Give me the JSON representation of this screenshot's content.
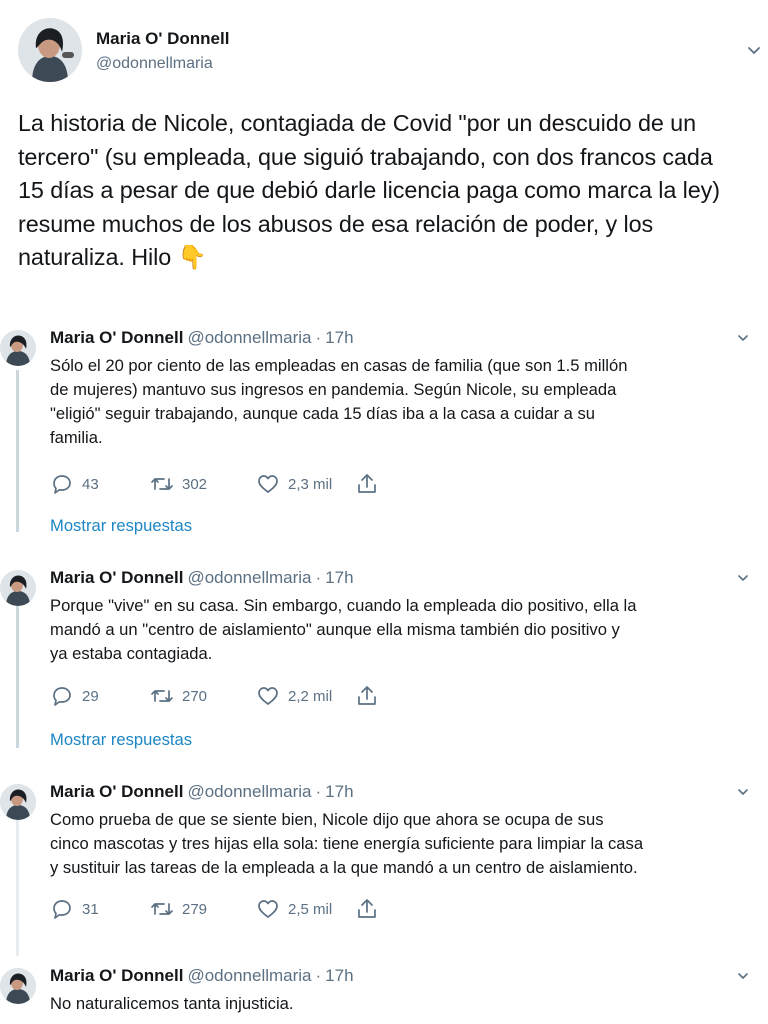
{
  "main_tweet": {
    "author_name": "Maria O' Donnell",
    "author_handle": "@odonnellmaria",
    "text": "La historia de Nicole, contagiada de Covid \"por un descuido de un\ntercero\" (su empleada, que siguió trabajando, con dos francos cada\n15 días a pesar de que debió darle licencia paga como marca la ley)\nresume muchos de los abusos de esa relación de poder, y los\nnaturaliza. Hilo",
    "emoji": "👇"
  },
  "replies": [
    {
      "name": "Maria O' Donnell",
      "handle": "@odonnellmaria",
      "separator": "·",
      "time": "17h",
      "text": "Sólo el 20 por ciento de las empleadas en casas de familia (que son 1.5 millón\nde mujeres) mantuvo sus ingresos en pandemia. Según Nicole, su empleada\n\"eligió\" seguir trabajando, aunque cada 15 días iba a la casa a cuidar a su\nfamilia.",
      "replies_count": "43",
      "retweets_count": "302",
      "likes_count": "2,3 mil",
      "show_replies": "Mostrar respuestas"
    },
    {
      "name": "Maria O' Donnell",
      "handle": "@odonnellmaria",
      "separator": "·",
      "time": "17h",
      "text": "Porque \"vive\" en su casa. Sin embargo, cuando la empleada dio positivo, ella la\nmandó a un \"centro de aislamiento\" aunque ella misma también dio positivo y\nya estaba contagiada.",
      "replies_count": "29",
      "retweets_count": "270",
      "likes_count": "2,2 mil",
      "show_replies": "Mostrar respuestas"
    },
    {
      "name": "Maria O' Donnell",
      "handle": "@odonnellmaria",
      "separator": "·",
      "time": "17h",
      "text": "Como prueba de que se siente bien, Nicole dijo que ahora se ocupa de sus\ncinco mascotas y tres hijas ella sola: tiene energía suficiente para limpiar la casa\ny sustituir las tareas de la empleada a la que mandó a un centro de aislamiento.",
      "replies_count": "31",
      "retweets_count": "279",
      "likes_count": "2,5 mil"
    },
    {
      "name": "Maria O' Donnell",
      "handle": "@odonnellmaria",
      "separator": "·",
      "time": "17h",
      "text": "No naturalicemos tanta injusticia."
    }
  ],
  "colors": {
    "text": "#14171a",
    "secondary": "#5b7083",
    "link": "#1d86c4",
    "thread_line": "#ccd6dd"
  },
  "icons": [
    "user-avatar",
    "chevron-down-icon",
    "reply-icon",
    "retweet-icon",
    "heart-icon",
    "share-icon",
    "pointing-down-emoji"
  ]
}
